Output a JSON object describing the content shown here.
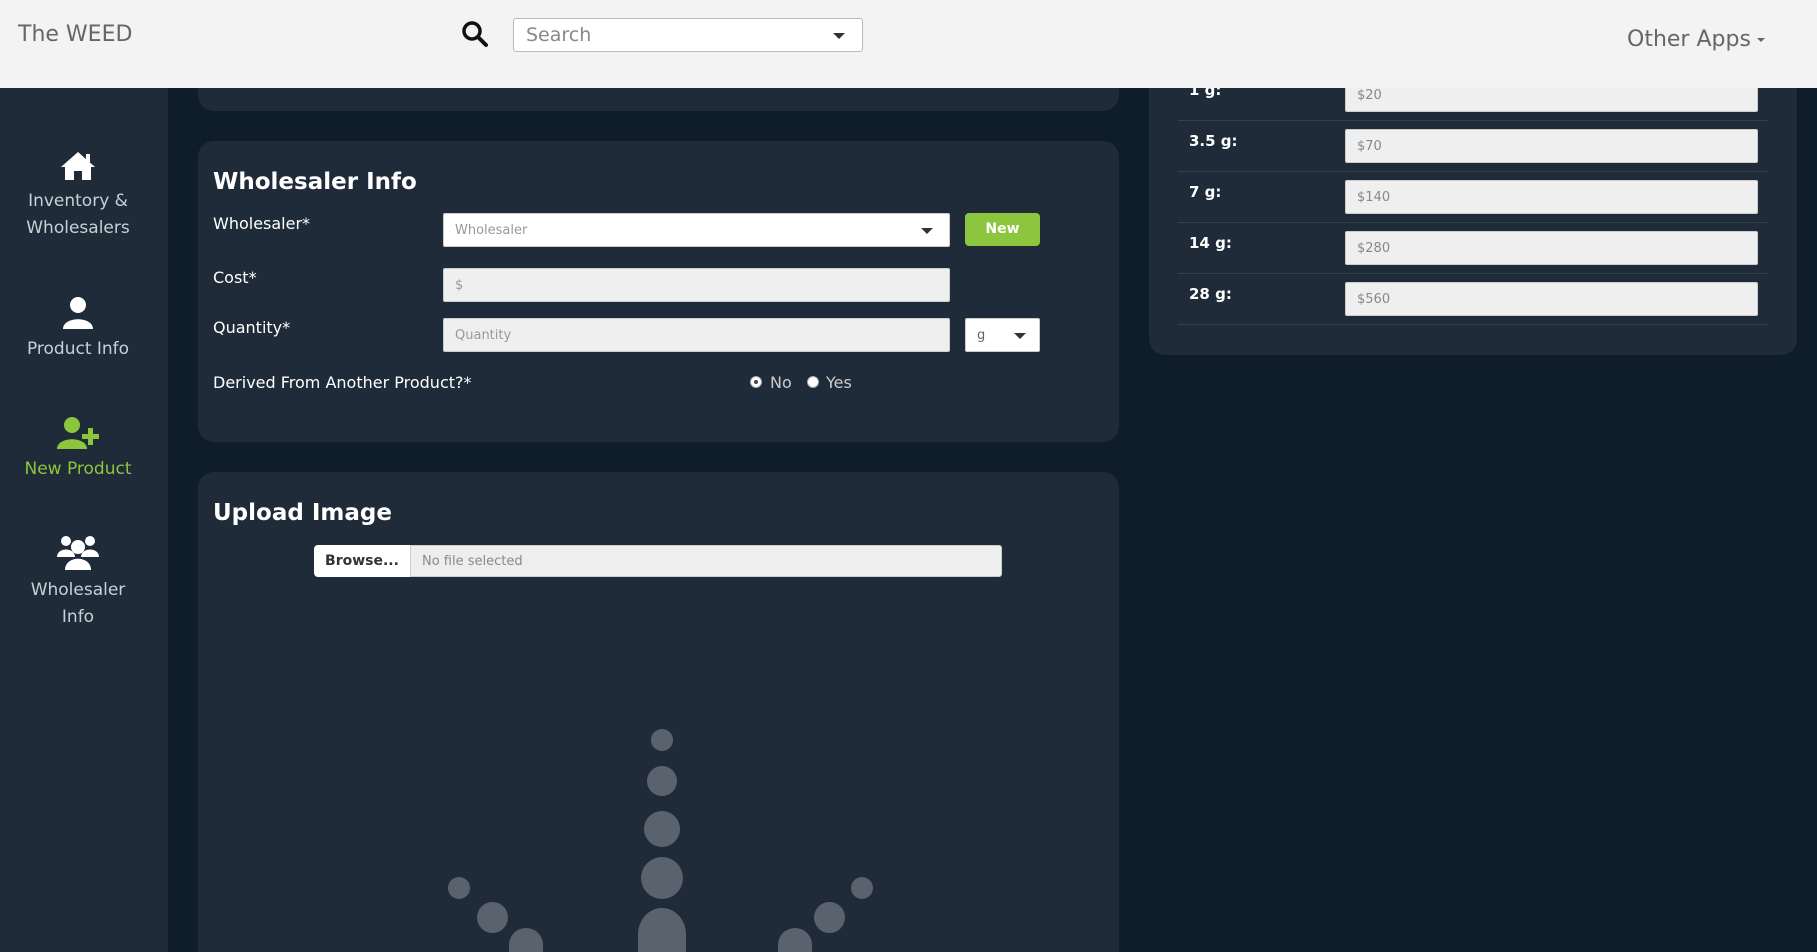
{
  "header": {
    "brand": "The WEED",
    "search_placeholder": "Search",
    "other_apps": "Other Apps"
  },
  "sidebar": {
    "items": [
      {
        "label": "Inventory &\nWholesalers",
        "icon": "home-icon"
      },
      {
        "label": "Product Info",
        "icon": "user-icon"
      },
      {
        "label": "New Product",
        "icon": "user-plus-icon",
        "active": true
      },
      {
        "label": "Wholesaler\nInfo",
        "icon": "users-icon"
      }
    ]
  },
  "wholesaler_info": {
    "title": "Wholesaler Info",
    "wholesaler_label": "Wholesaler*",
    "wholesaler_placeholder": "Wholesaler",
    "new_button": "New",
    "cost_label": "Cost*",
    "cost_placeholder": "$",
    "quantity_label": "Quantity*",
    "quantity_placeholder": "Quantity",
    "unit_value": "g",
    "derived_label": "Derived From Another Product?*",
    "derived_options": [
      "No",
      "Yes"
    ],
    "derived_selected": "No"
  },
  "upload_image": {
    "title": "Upload Image",
    "browse_label": "Browse...",
    "file_placeholder": "No file selected"
  },
  "pricing": {
    "rows": [
      {
        "label": "1 g:",
        "placeholder": "$20"
      },
      {
        "label": "3.5 g:",
        "placeholder": "$70"
      },
      {
        "label": "7 g:",
        "placeholder": "$140"
      },
      {
        "label": "14 g:",
        "placeholder": "$280"
      },
      {
        "label": "28 g:",
        "placeholder": "$560"
      }
    ]
  },
  "colors": {
    "accent": "#8cc63f",
    "panel": "#1f2b38",
    "background": "#0f1d2a",
    "topbar": "#f3f3f3"
  }
}
